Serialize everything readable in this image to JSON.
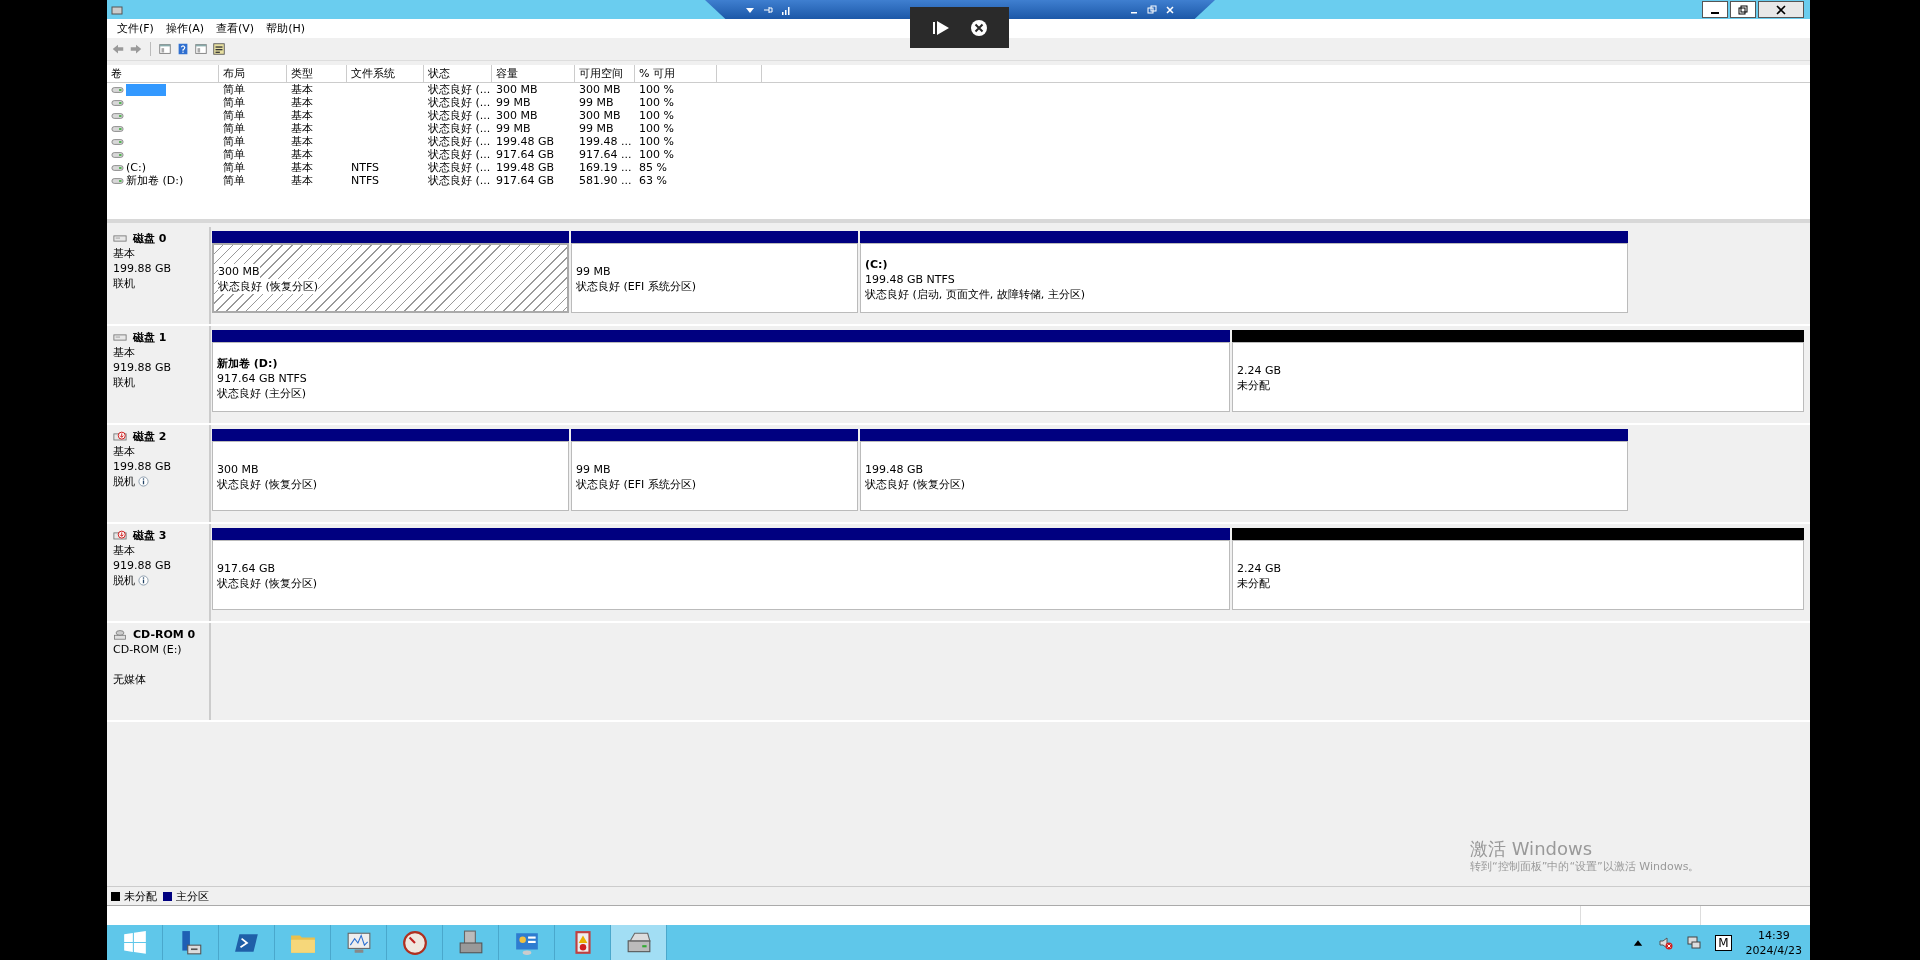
{
  "menu": [
    "文件(F)",
    "操作(A)",
    "查看(V)",
    "帮助(H)"
  ],
  "toolbar": [
    {
      "kind": "back"
    },
    {
      "kind": "forward"
    },
    {
      "kind": "panel"
    },
    {
      "kind": "help"
    },
    {
      "kind": "panel"
    },
    {
      "kind": "properties"
    }
  ],
  "volume_table": {
    "columns": [
      "卷",
      "布局",
      "类型",
      "文件系统",
      "状态",
      "容量",
      "可用空间",
      "% 可用"
    ],
    "rows": [
      {
        "selected": true,
        "layout": "简单",
        "type": "基本",
        "status": "状态良好 (...",
        "capacity": "300 MB",
        "free": "300 MB",
        "percent": "100 %"
      },
      {
        "selected": false,
        "layout": "简单",
        "type": "基本",
        "status": "状态良好 (...",
        "capacity": "99 MB",
        "free": "99 MB",
        "percent": "100 %"
      },
      {
        "selected": false,
        "layout": "简单",
        "type": "基本",
        "status": "状态良好 (...",
        "capacity": "300 MB",
        "free": "300 MB",
        "percent": "100 %"
      },
      {
        "selected": false,
        "layout": "简单",
        "type": "基本",
        "status": "状态良好 (...",
        "capacity": "99 MB",
        "free": "99 MB",
        "percent": "100 %"
      },
      {
        "selected": false,
        "layout": "简单",
        "type": "基本",
        "status": "状态良好 (...",
        "capacity": "199.48 GB",
        "free": "199.48 ...",
        "percent": "100 %"
      },
      {
        "selected": false,
        "layout": "简单",
        "type": "基本",
        "status": "状态良好 (...",
        "capacity": "917.64 GB",
        "free": "917.64 ...",
        "percent": "100 %"
      },
      {
        "selected": false,
        "volume": "(C:)",
        "layout": "简单",
        "type": "基本",
        "filesystem": "NTFS",
        "status": "状态良好 (...",
        "capacity": "199.48 GB",
        "free": "169.19 ...",
        "percent": "85 %"
      },
      {
        "selected": false,
        "volume": "新加卷 (D:)",
        "layout": "简单",
        "type": "基本",
        "filesystem": "NTFS",
        "status": "状态良好 (...",
        "capacity": "917.64 GB",
        "free": "581.90 ...",
        "percent": "63 %"
      }
    ]
  },
  "disks": [
    {
      "kind": "disk",
      "name": "磁盘 0",
      "type": "基本",
      "size": "199.88 GB",
      "status": "联机",
      "info_icon": false,
      "partitions": [
        {
          "kind": "primary",
          "selected": true,
          "size": "300 MB",
          "status": "状态良好 (恢复分区)"
        },
        {
          "kind": "primary",
          "selected": false,
          "size": "99 MB",
          "status": "状态良好 (EFI 系统分区)"
        },
        {
          "kind": "primary",
          "selected": false,
          "title": "(C:)",
          "size": "199.48 GB NTFS",
          "status": "状态良好 (启动, 页面文件, 故障转储, 主分区)"
        }
      ]
    },
    {
      "kind": "disk",
      "name": "磁盘 1",
      "type": "基本",
      "size": "919.88 GB",
      "status": "联机",
      "info_icon": false,
      "partitions": [
        {
          "kind": "primary",
          "selected": false,
          "title": "新加卷  (D:)",
          "size": "917.64 GB NTFS",
          "status": "状态良好 (主分区)"
        },
        {
          "kind": "unallocated",
          "selected": false,
          "size": "2.24 GB",
          "status": "未分配"
        }
      ]
    },
    {
      "kind": "disk-offline",
      "name": "磁盘 2",
      "type": "基本",
      "size": "199.88 GB",
      "status": "脱机",
      "info_icon": true,
      "partitions": [
        {
          "kind": "primary",
          "selected": false,
          "size": "300 MB",
          "status": "状态良好 (恢复分区)"
        },
        {
          "kind": "primary",
          "selected": false,
          "size": "99 MB",
          "status": "状态良好 (EFI 系统分区)"
        },
        {
          "kind": "primary",
          "selected": false,
          "size": "199.48 GB",
          "status": "状态良好 (恢复分区)"
        }
      ]
    },
    {
      "kind": "disk-offline",
      "name": "磁盘 3",
      "type": "基本",
      "size": "919.88 GB",
      "status": "脱机",
      "info_icon": true,
      "partitions": [
        {
          "kind": "primary",
          "selected": false,
          "size": "917.64 GB",
          "status": "状态良好 (恢复分区)"
        },
        {
          "kind": "unallocated",
          "selected": false,
          "size": "2.24 GB",
          "status": "未分配"
        }
      ]
    },
    {
      "kind": "cdrom",
      "name": "CD-ROM 0",
      "type": "CD-ROM (E:)",
      "status": "无媒体",
      "info_icon": false
    }
  ],
  "legend": [
    {
      "label": "未分配",
      "color": "#000000"
    },
    {
      "label": "主分区",
      "color": "#000080"
    }
  ],
  "activation": {
    "title": "激活 Windows",
    "subtitle": "转到“控制面板”中的“设置”以激活 Windows。"
  },
  "taskbar": {
    "apps": [
      {
        "kind": "start",
        "selected": false
      },
      {
        "kind": "server",
        "selected": false
      },
      {
        "kind": "powershell",
        "selected": false
      },
      {
        "kind": "folder",
        "selected": false
      },
      {
        "kind": "monitor",
        "selected": false
      },
      {
        "kind": "gauge",
        "selected": false
      },
      {
        "kind": "toolbox",
        "selected": false
      },
      {
        "kind": "panel",
        "selected": false
      },
      {
        "kind": "log",
        "selected": false
      },
      {
        "kind": "disk",
        "selected": true
      }
    ],
    "input_indicator": "M",
    "time": "14:39",
    "date": "2024/4/23"
  }
}
